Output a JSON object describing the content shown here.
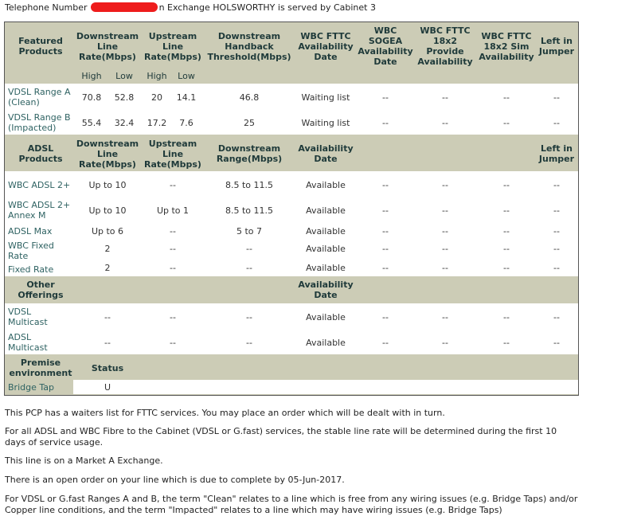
{
  "top_line": {
    "prefix": "Telephone Number",
    "suffix": "n Exchange HOLSWORTHY is served by Cabinet 3"
  },
  "headers": {
    "featured_products": "Featured Products",
    "downstream": "Downstream Line Rate(Mbps)",
    "upstream": "Upstream Line Rate(Mbps)",
    "handback": "Downstream Handback Threshold(Mbps)",
    "fttc_avail": "WBC FTTC Availability Date",
    "sogea": "WBC SOGEA Availability Date",
    "fttc_18x2_provide": "WBC FTTC 18x2 Provide Availability",
    "fttc_18x2_sim": "WBC FTTC 18x2 Sim Availability",
    "left_in_jumper": "Left in Jumper",
    "high": "High",
    "low": "Low"
  },
  "vdsl_rows": [
    {
      "name": "VDSL Range A (Clean)",
      "cells": [
        "70.8",
        "52.8",
        "20",
        "14.1",
        "46.8",
        "Waiting list",
        "--",
        "--",
        "--",
        "--"
      ]
    },
    {
      "name": "VDSL Range B (Impacted)",
      "cells": [
        "55.4",
        "32.4",
        "17.2",
        "7.6",
        "25",
        "Waiting list",
        "--",
        "--",
        "--",
        "--"
      ]
    }
  ],
  "adsl_headers": {
    "products": "ADSL Products",
    "downstream": "Downstream Line Rate(Mbps)",
    "upstream": "Upstream Line Rate(Mbps)",
    "range": "Downstream Range(Mbps)",
    "availability": "Availability Date",
    "left_in_jumper": "Left in Jumper"
  },
  "adsl_rows": [
    {
      "name": "WBC ADSL 2+",
      "cells": [
        "Up to 10",
        "--",
        "8.5 to 11.5",
        "Available",
        "--",
        "--",
        "--",
        "--"
      ]
    },
    {
      "name": "WBC ADSL 2+ Annex M",
      "cells": [
        "Up to 10",
        "Up to 1",
        "8.5 to 11.5",
        "Available",
        "--",
        "--",
        "--",
        "--"
      ]
    },
    {
      "name": "ADSL Max",
      "cells": [
        "Up to 6",
        "--",
        "5 to 7",
        "Available",
        "--",
        "--",
        "--",
        "--"
      ]
    },
    {
      "name": "WBC Fixed Rate",
      "cells": [
        "2",
        "--",
        "--",
        "Available",
        "--",
        "--",
        "--",
        "--"
      ]
    },
    {
      "name": "Fixed Rate",
      "cells": [
        "2",
        "--",
        "--",
        "Available",
        "--",
        "--",
        "--",
        "--"
      ]
    }
  ],
  "other_headers": {
    "offerings": "Other Offerings",
    "availability": "Availability Date"
  },
  "other_rows": [
    {
      "name": "VDSL Multicast",
      "cells": [
        "--",
        "--",
        "--",
        "Available",
        "--",
        "--",
        "--",
        "--"
      ]
    },
    {
      "name": "ADSL Multicast",
      "cells": [
        "--",
        "--",
        "--",
        "Available",
        "--",
        "--",
        "--",
        "--"
      ]
    }
  ],
  "premise_headers": {
    "environment": "Premise environment",
    "status": "Status"
  },
  "premise_rows": [
    {
      "name": "Bridge Tap",
      "status": "U"
    }
  ],
  "notes": [
    "This PCP has a waiters list for FTTC services. You may place an order which will be dealt with in turn.",
    "For all ADSL and WBC Fibre to the Cabinet (VDSL or G.fast) services, the stable line rate will be determined during the first 10 days of service usage.",
    "This line is on a Market A Exchange.",
    "There is an open order on your line which is due to complete by 05-Jun-2017.",
    "For VDSL or G.fast Ranges A and B, the term \"Clean\" relates to a line which is free from any wiring issues (e.g. Bridge Taps) and/or Copper line conditions, and the term \"Impacted\" relates to a line which may have wiring issues (e.g. Bridge Taps)"
  ]
}
